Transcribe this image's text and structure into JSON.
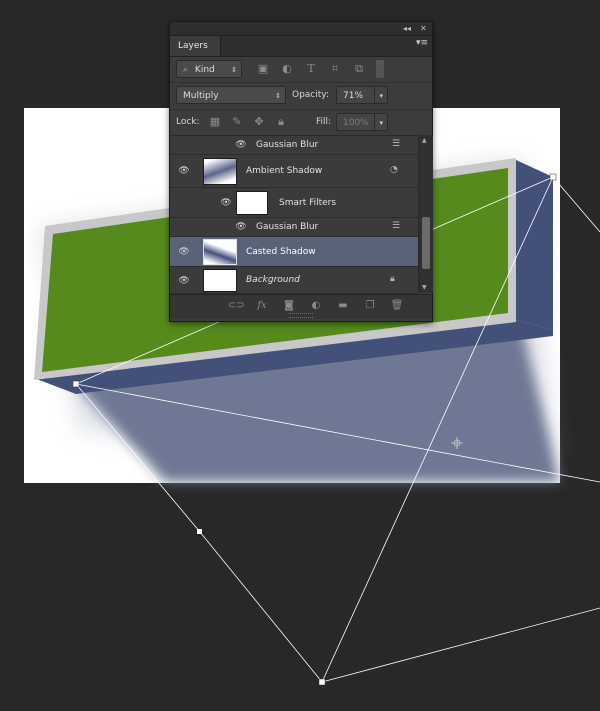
{
  "colors": {
    "app_background": "#282828",
    "canvas": "#ffffff",
    "green_face": "#568a1d",
    "frame": "#c8c8c8",
    "side_face": "#43507a",
    "shadow": "#6e7894",
    "selected_layer": "#586378",
    "path_line": "#ffffff"
  },
  "panel": {
    "tab_label": "Layers",
    "collapse_icon": "double-chevron-icon",
    "close_icon": "close-icon",
    "menu_icon": "panel-menu-icon",
    "filter": {
      "kind_label": "Kind",
      "icons": [
        "image-filter-icon",
        "adjustment-filter-icon",
        "type-filter-icon",
        "shape-filter-icon",
        "smart-object-filter-icon",
        "filter-toggle-icon"
      ]
    },
    "blend_mode": "Multiply",
    "opacity_label": "Opacity:",
    "opacity_value": "71%",
    "lock_label": "Lock:",
    "lock_icons": [
      "lock-transparent-icon",
      "lock-image-icon",
      "lock-position-icon",
      "lock-all-icon"
    ],
    "fill_label": "Fill:",
    "fill_value": "100%",
    "layers": [
      {
        "name": "Gaussian Blur",
        "kind": "filter"
      },
      {
        "name": "Ambient Shadow",
        "kind": "smart-object"
      },
      {
        "name": "Smart Filters",
        "kind": "smart-filters"
      },
      {
        "name": "Gaussian Blur",
        "kind": "filter"
      },
      {
        "name": "Casted Shadow",
        "kind": "smart-object",
        "selected": true
      },
      {
        "name": "Background",
        "kind": "background",
        "locked": true
      }
    ],
    "footer_icons": [
      "link-layers-icon",
      "fx-icon",
      "add-mask-icon",
      "adjustment-layer-icon",
      "new-group-icon",
      "new-layer-icon",
      "trash-icon"
    ]
  }
}
